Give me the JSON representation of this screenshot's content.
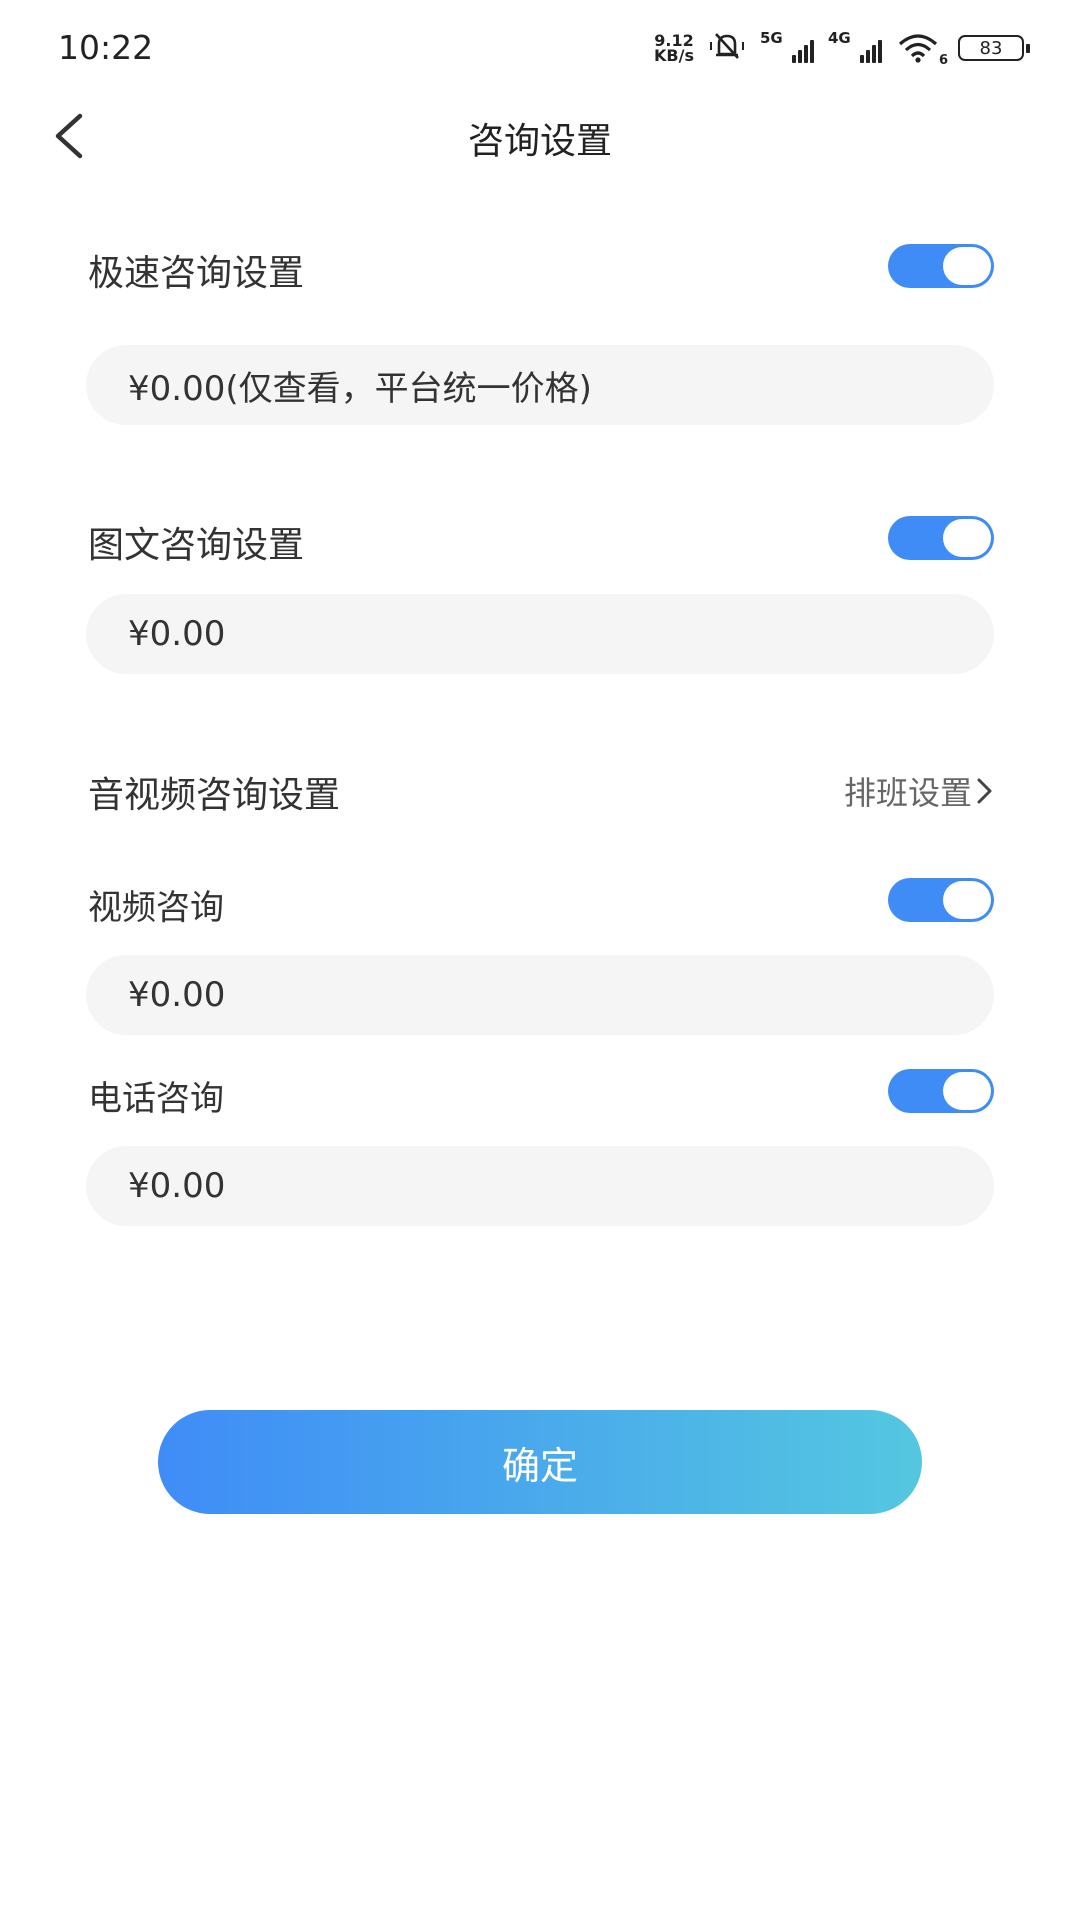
{
  "status_bar": {
    "time": "10:22",
    "net_speed_value": "9.12",
    "net_speed_unit": "KB/s",
    "signal1_label": "5G",
    "signal2_label": "4G",
    "wifi_sub": "6",
    "battery": "83"
  },
  "nav": {
    "title": "咨询设置"
  },
  "rapid": {
    "label": "极速咨询设置",
    "enabled": true,
    "price": "¥0.00(仅查看，平台统一价格)"
  },
  "text_image": {
    "label": "图文咨询设置",
    "enabled": true,
    "price": "¥0.00"
  },
  "av": {
    "label": "音视频咨询设置",
    "schedule_link": "排班设置"
  },
  "video": {
    "label": "视频咨询",
    "enabled": true,
    "price": "¥0.00"
  },
  "phone": {
    "label": "电话咨询",
    "enabled": true,
    "price": "¥0.00"
  },
  "confirm_label": "确定",
  "colors": {
    "accent": "#3f8cf7",
    "gradient_end": "#54c7e0",
    "field_bg": "#f5f5f5"
  }
}
